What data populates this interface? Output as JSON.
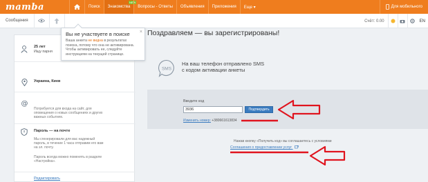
{
  "topnav": {
    "logo": "mamba",
    "items": [
      {
        "label": "Поиск"
      },
      {
        "label": "Знакомства",
        "badge": "NEW"
      },
      {
        "label": "Вопросы - Ответы"
      },
      {
        "label": "Объявления"
      },
      {
        "label": "Приложения"
      },
      {
        "label": "Еще ▾"
      }
    ],
    "mobile": "Для мобильного"
  },
  "subbar": {
    "messages": "Сообщения",
    "score_label": "Счёт: 0.00",
    "lang": "EN"
  },
  "tooltip": {
    "title": "Вы не участвуете в поиске",
    "line1_pre": "Ваша анкета ",
    "line1_hl": "не видна",
    "line1_post": " в результатах",
    "line2": "поиска, потому что она не активирована.",
    "line3": "Чтобы активировать ее, следуйте",
    "line4": "инструкциям на текущей странице."
  },
  "profile": {
    "age": "25 лет",
    "seeking": "Ищу парня",
    "location": "Украина, Киев",
    "email_note_1": "Потребуется для входа на сайт, для",
    "email_note_2": "оповещения о новых сообщениях и других",
    "email_note_3": "важных событиях.",
    "password_title": "Пароль — на почте",
    "password_note_1": "Мы сгенерировали для вас надежный",
    "password_note_2": "пароль, в течение 1 часа отправим его вам",
    "password_note_3": "на эл. почту.",
    "password_note_4": "Пароль всегда можно поменять в разделе",
    "password_note_5": "«Настройка».",
    "edit_link": "Редактировать"
  },
  "main": {
    "title": "Поздравляем — вы зарегистрированы!",
    "sms_icon_label": "SMS",
    "sms_line1": "На ваш телефон отправлено SMS",
    "sms_line2": "с кодом активации анкеты",
    "code_label": "Введите код",
    "code_value": "3936",
    "confirm_button": "Подтвердить",
    "change_number": "Изменить номер:",
    "phone_number": "+380661613834",
    "terms_text": "Нажав кнопку «Получить код» вы соглашаетесь с условиями",
    "terms_link": "Соглашения о предоставлении услуг"
  },
  "colors": {
    "brand_orange": "#ef7d1e",
    "link_blue": "#3a7bbf",
    "annotation_red": "#e0141e"
  }
}
